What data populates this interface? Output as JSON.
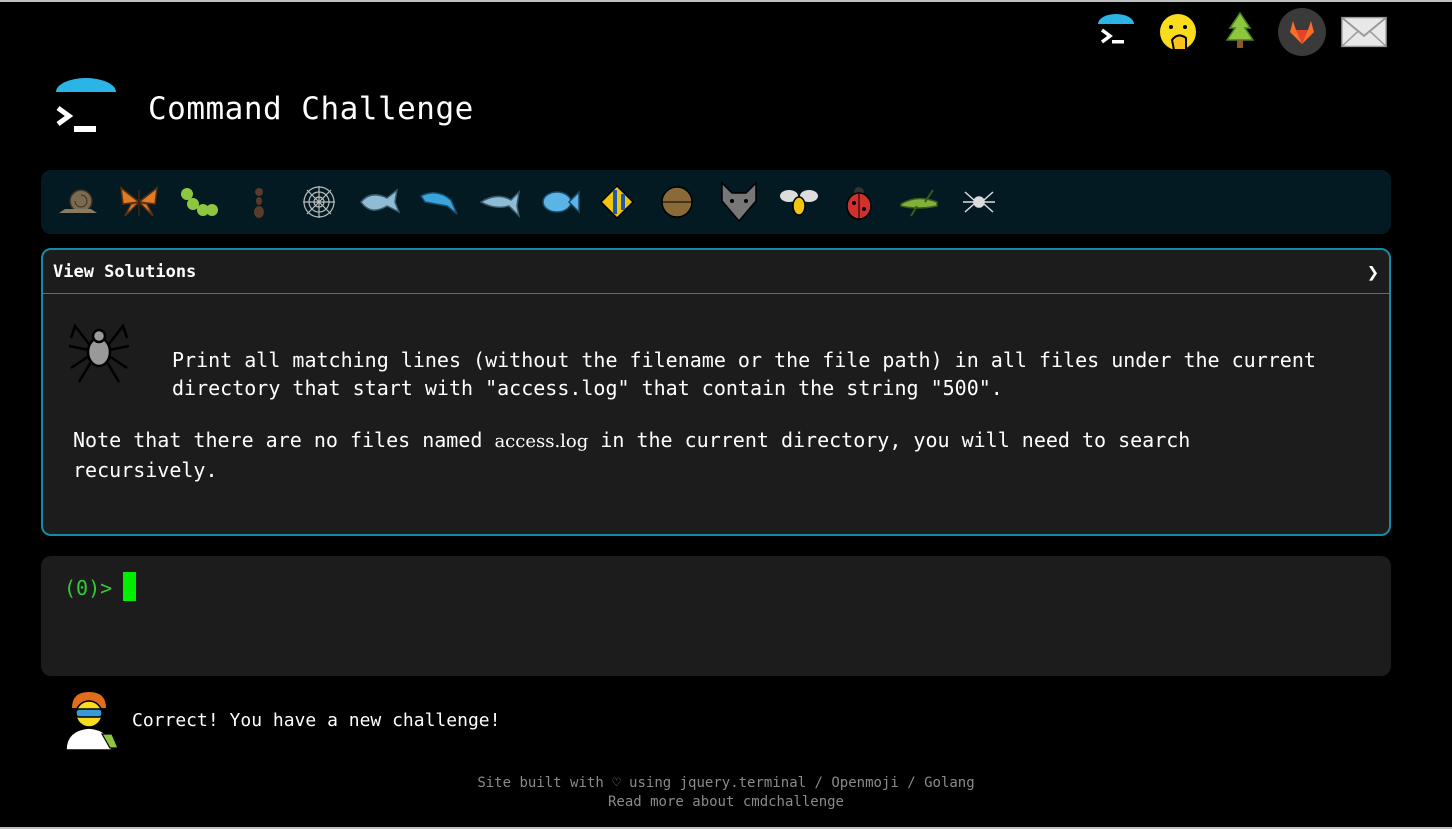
{
  "header": {
    "title": "Command Challenge",
    "top_icons": [
      "terminal-icon",
      "face-with-hand-over-mouth-icon",
      "christmas-tree-icon",
      "gitlab-icon",
      "envelope-icon"
    ]
  },
  "animal_bar": {
    "items": [
      "snail-icon",
      "butterfly-icon",
      "caterpillar-icon",
      "ant-icon",
      "spider-web-icon",
      "whale-icon",
      "dolphin-icon",
      "shark-icon",
      "fish-icon",
      "tropical-fish-icon",
      "blowfish-icon",
      "wolf-icon",
      "honeybee-icon",
      "ladybug-icon",
      "cricket-icon",
      "spider-icon"
    ]
  },
  "panel": {
    "header_label": "View Solutions",
    "chevron": "❯",
    "description": "Print all matching lines (without the filename or the file path) in all files under the current directory that start with \"access.log\" that contain the string \"500\".",
    "note_before": "Note that there are no files named ",
    "note_code": "access.log",
    "note_after": " in the current directory, you will need to search recursively."
  },
  "terminal": {
    "prompt": "(0)>"
  },
  "status": {
    "message": "Correct! You have a new challenge!"
  },
  "footer": {
    "line1_prefix": "Site built with ♡ using ",
    "link_jquery": "jquery.terminal",
    "sep1": " / ",
    "link_openmoji": "Openmoji",
    "sep2": " / ",
    "link_golang": "Golang",
    "line2_prefix": "Read more about ",
    "link_about": "cmdchallenge"
  }
}
